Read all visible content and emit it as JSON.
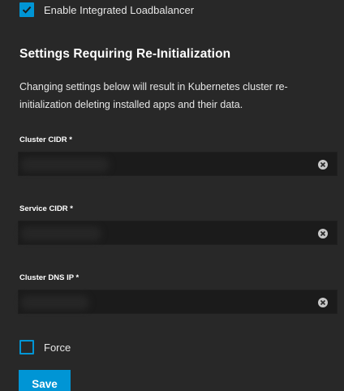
{
  "loadbalancer": {
    "label": "Enable Integrated Loadbalancer",
    "checked": true
  },
  "section": {
    "title": "Settings Requiring Re-Initialization",
    "description": "Changing settings below will result in Kubernetes cluster re-initialization deleting installed apps and their data."
  },
  "fields": {
    "cluster_cidr": {
      "label": "Cluster CIDR *",
      "value": ""
    },
    "service_cidr": {
      "label": "Service CIDR *",
      "value": ""
    },
    "cluster_dns_ip": {
      "label": "Cluster DNS IP *",
      "value": ""
    }
  },
  "force": {
    "label": "Force",
    "checked": false
  },
  "actions": {
    "save_label": "Save"
  },
  "colors": {
    "accent": "#0095d5",
    "background": "#282828",
    "input_background": "#1b1b1b"
  },
  "icons": {
    "check": "check-icon",
    "clear": "clear-icon"
  }
}
